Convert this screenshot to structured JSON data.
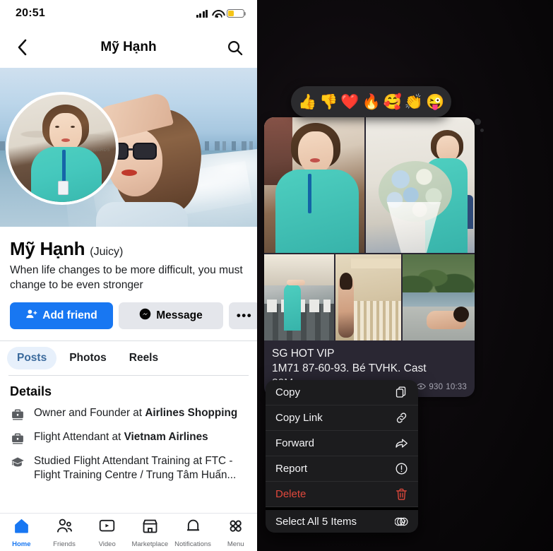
{
  "left": {
    "status_bar": {
      "time": "20:51",
      "signal_icon": "cellular-bars-icon",
      "wifi_icon": "wifi-icon",
      "battery_icon": "battery-low-icon",
      "battery_color": "#f5c518"
    },
    "nav": {
      "back_icon": "chevron-left-icon",
      "title": "Mỹ Hạnh",
      "search_icon": "search-icon"
    },
    "profile": {
      "name": "Mỹ Hạnh",
      "nickname": "(Juicy)",
      "bio": "When life changes to be more difficult, you must change to be even stronger",
      "cover_alt": "woman-on-speedboat-cover-photo",
      "avatar_alt": "flight-attendant-profile-photo"
    },
    "actions": {
      "add_friend": "Add friend",
      "add_friend_icon": "person-add-icon",
      "message": "Message",
      "message_icon": "messenger-icon",
      "more": "•••",
      "accent_color": "#1877f2"
    },
    "tabs": [
      {
        "label": "Posts",
        "active": true
      },
      {
        "label": "Photos",
        "active": false
      },
      {
        "label": "Reels",
        "active": false
      }
    ],
    "details": {
      "heading": "Details",
      "rows": [
        {
          "icon": "briefcase-icon",
          "text": "Owner and Founder at ",
          "bold": "Airlines Shopping",
          "tail": ""
        },
        {
          "icon": "briefcase-icon",
          "text": "Flight Attendant at ",
          "bold": "Vietnam Airlines",
          "tail": ""
        },
        {
          "icon": "graduation-cap-icon",
          "text": "Studied Flight Attendant Training at FTC - Flight Training Centre / Trung Tâm Huấn...",
          "bold": "",
          "tail": ""
        }
      ]
    },
    "bottom_nav": [
      {
        "label": "Home",
        "icon": "home-icon",
        "active": true
      },
      {
        "label": "Friends",
        "icon": "friends-icon",
        "active": false
      },
      {
        "label": "Video",
        "icon": "video-icon",
        "active": false
      },
      {
        "label": "Marketplace",
        "icon": "marketplace-icon",
        "active": false
      },
      {
        "label": "Notifications",
        "icon": "bell-icon",
        "active": false
      },
      {
        "label": "Menu",
        "icon": "menu-grid-icon",
        "active": false
      }
    ]
  },
  "right": {
    "reactions": [
      {
        "name": "thumbs-up-reaction",
        "glyph": "👍"
      },
      {
        "name": "thumbs-down-reaction",
        "glyph": "👎"
      },
      {
        "name": "heart-reaction",
        "glyph": "❤️"
      },
      {
        "name": "fire-reaction",
        "glyph": "🔥"
      },
      {
        "name": "smiling-face-with-hearts-reaction",
        "glyph": "🥰"
      },
      {
        "name": "clapping-hands-reaction",
        "glyph": "👏"
      },
      {
        "name": "winking-face-reaction",
        "glyph": "😜"
      }
    ],
    "message": {
      "caption_line1": "SG HOT VIP",
      "caption_line2": "1M71 87-60-93. Bé TVHK. Cast",
      "caption_line3": "20M.",
      "views_icon": "eye-icon",
      "views": "930",
      "time": "10:33",
      "album_count": 5,
      "photos": [
        {
          "alt": "flight-attendant-selfie-in-lobby"
        },
        {
          "alt": "woman-holding-blue-flower-bouquet"
        },
        {
          "alt": "flight-attendant-in-aircraft-cabin"
        },
        {
          "alt": "woman-posing-by-wooden-building"
        },
        {
          "alt": "woman-reclining-beside-pool"
        }
      ]
    },
    "context_menu": [
      {
        "label": "Copy",
        "icon": "copy-icon",
        "danger": false
      },
      {
        "label": "Copy Link",
        "icon": "link-icon",
        "danger": false
      },
      {
        "label": "Forward",
        "icon": "forward-arrow-icon",
        "danger": false
      },
      {
        "label": "Report",
        "icon": "report-exclamation-icon",
        "danger": false
      },
      {
        "label": "Delete",
        "icon": "trash-icon",
        "danger": true
      },
      {
        "label": "Select All 5 Items",
        "icon": "select-all-icon",
        "danger": false
      }
    ],
    "danger_color": "#e0483c"
  }
}
